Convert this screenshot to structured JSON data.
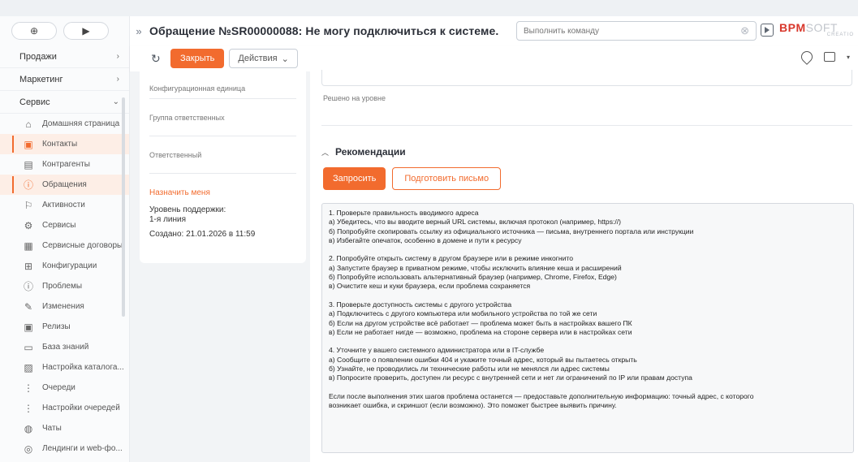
{
  "header": {
    "title": "Обращение №SR00000088: Не могу подключиться к системе.",
    "command_placeholder": "Выполнить команду",
    "logo_main_a": "BPM",
    "logo_main_b": "SOFT",
    "logo_sub": "CREATIO"
  },
  "toolbar": {
    "close_label": "Закрыть",
    "actions_label": "Действия"
  },
  "sidebar": {
    "groups": [
      {
        "label": "Продажи"
      },
      {
        "label": "Маркетинг"
      },
      {
        "label": "Сервис"
      }
    ],
    "items": [
      {
        "label": "Домашняя страница",
        "icon": "home-icon"
      },
      {
        "label": "Контакты",
        "icon": "contact-icon"
      },
      {
        "label": "Контрагенты",
        "icon": "account-icon"
      },
      {
        "label": "Обращения",
        "icon": "case-icon"
      },
      {
        "label": "Активности",
        "icon": "flag-icon"
      },
      {
        "label": "Сервисы",
        "icon": "services-icon"
      },
      {
        "label": "Сервисные договоры",
        "icon": "contract-icon"
      },
      {
        "label": "Конфигурации",
        "icon": "config-icon"
      },
      {
        "label": "Проблемы",
        "icon": "problem-icon"
      },
      {
        "label": "Изменения",
        "icon": "pencil-icon"
      },
      {
        "label": "Релизы",
        "icon": "calendar-icon"
      },
      {
        "label": "База знаний",
        "icon": "book-icon"
      },
      {
        "label": "Настройка каталога...",
        "icon": "catalog-icon"
      },
      {
        "label": "Очереди",
        "icon": "queue-icon"
      },
      {
        "label": "Настройки очередей",
        "icon": "queue-settings-icon"
      },
      {
        "label": "Чаты",
        "icon": "chat-icon"
      },
      {
        "label": "Лендинги и web-фо...",
        "icon": "landing-icon"
      }
    ]
  },
  "leftpanel": {
    "config_unit": "Конфигурационная единица",
    "group": "Группа ответственных",
    "responsible": "Ответственный",
    "assign_me": "Назначить меня",
    "support_level_label": "Уровень поддержки:",
    "support_level_value": "1-я линия",
    "created": "Создано: 21.01.2026 в 11:59"
  },
  "main": {
    "solved_at_level": "Решено на уровне",
    "recommendations_title": "Рекомендации",
    "request_button": "Запросить",
    "prepare_letter_button": "Подготовить письмо",
    "recommendation_lines": [
      "1. Проверьте правильность вводимого адреса",
      "а) Убедитесь, что вы вводите верный URL системы, включая протокол (например, https://)",
      "б) Попробуйте скопировать ссылку из официального источника — письма, внутреннего портала или инструкции",
      "в) Избегайте опечаток, особенно в домене и пути к ресурсу",
      "",
      "2. Попробуйте открыть систему в другом браузере или в режиме инкогнито",
      "а) Запустите браузер в приватном режиме, чтобы исключить влияние кеша и расширений",
      "б) Попробуйте использовать альтернативный браузер (например, Chrome, Firefox, Edge)",
      "в) Очистите кеш и куки браузера, если проблема сохраняется",
      "",
      "3. Проверьте доступность системы с другого устройства",
      "а) Подключитесь с другого компьютера или мобильного устройства по той же сети",
      "б) Если на другом устройстве всё работает — проблема может быть в настройках вашего ПК",
      "в) Если не работает нигде — возможно, проблема на стороне сервера или в настройках сети",
      "",
      "4. Уточните у вашего системного администратора или в IT-службе",
      "а) Сообщите о появлении ошибки 404 и укажите точный адрес, который вы пытаетесь открыть",
      "б) Узнайте, не проводились ли технические работы или не менялся ли адрес системы",
      "в) Попросите проверить, доступен ли ресурс с внутренней сети и нет ли ограничений по IP или правам доступа",
      "",
      "Если после выполнения этих шагов проблема останется — предоставьте дополнительную информацию: точный адрес, с которого",
      "возникает ошибка, и скриншот (если возможно). Это поможет быстрее выявить причину."
    ]
  }
}
